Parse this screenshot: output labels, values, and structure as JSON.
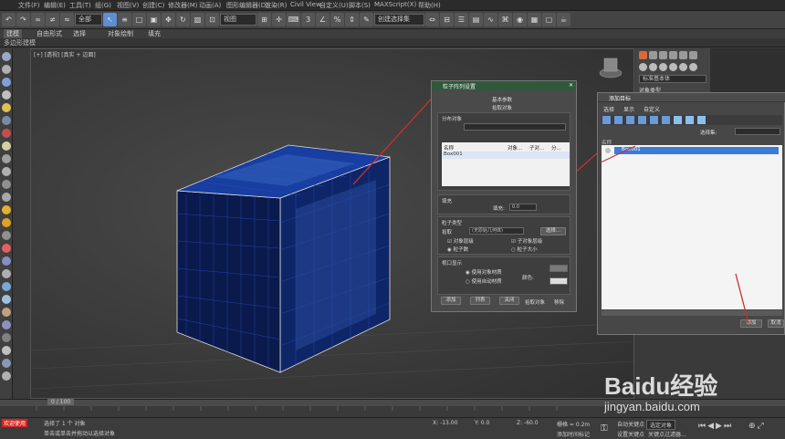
{
  "menu": {
    "items": [
      "文件(F)",
      "编辑(E)",
      "工具(T)",
      "组(G)",
      "视图(V)",
      "创建(C)",
      "修改器(M)",
      "动画(A)",
      "图形编辑器(D)",
      "渲染(R)",
      "Civil View",
      "自定义(U)",
      "脚本(S)",
      "MAXScript(X)",
      "帮助(H)"
    ]
  },
  "toolbar": {
    "selection_filter": "全部",
    "view_select": "视图",
    "named_selection": "创建选择集"
  },
  "ribbon": {
    "tabs": [
      "建模",
      "自由形式",
      "选择",
      "对象绘制",
      "填充"
    ],
    "sub_label": "多边形建模"
  },
  "viewport": {
    "label": "[+] [透视] [真实 + 边面]"
  },
  "command_panel": {
    "dropdown": "标准基本体",
    "rollout": "对象类型"
  },
  "particle_dialog": {
    "title": "粒子阵列设置",
    "sections": {
      "basic": "基本参数",
      "source": "拾取对象",
      "distribution": "分布对象",
      "particles_from_object": "粒子类型",
      "fill": "填充",
      "viewport_display": "视口显示",
      "render": "渲染"
    },
    "table_headers": [
      "名称",
      "对象...",
      "子对...",
      "分..."
    ],
    "table_row": "Box001",
    "fill_label": "填充:",
    "fill_value": "0.0",
    "pick_label": "拾取",
    "none_option": "(无原始几何体)",
    "pick_button": "选择...",
    "checks": [
      "对象层级",
      "子对象层级"
    ],
    "radios": [
      "粒子数",
      "粒子大小"
    ],
    "radio_options": [
      "使用对象材质",
      "使用自动材质"
    ],
    "bottom_buttons": [
      "添加",
      "列表",
      "关闭",
      "移除"
    ],
    "color_label": "颜色:",
    "bottom_extra": "拾取对象"
  },
  "add_dialog": {
    "title": "添加目标",
    "menu": [
      "选择",
      "显示",
      "自定义"
    ],
    "section_label": "名称",
    "selection_set_label": "选择集:",
    "list_item": "Box001",
    "ok": "添加",
    "cancel": "取消"
  },
  "timeline": {
    "frame": "0 / 100",
    "ticks": [
      "0",
      "5",
      "10",
      "15",
      "20",
      "25",
      "30",
      "35",
      "40",
      "45",
      "50",
      "55",
      "60",
      "65",
      "70",
      "75",
      "80",
      "85",
      "90",
      "95",
      "100"
    ]
  },
  "status": {
    "message": "选择了 1 个 对象",
    "hint": "单击或单击并拖动以选择对象",
    "x": "X: -13.00",
    "y": "Y: 0.0",
    "z": "Z: -60.0",
    "grid": "栅格 = 0.2m",
    "add_key": "添加时间标记",
    "auto_key": "自动关键点",
    "selected": "选定对象",
    "set_key": "设置关键点",
    "key_filter": "关键点过滤器...",
    "welcome": "欢迎使用"
  },
  "watermark": {
    "brand": "Baidu经验",
    "url": "jingyan.baidu.com"
  },
  "colors": {
    "cube_face": "#0b1f5c",
    "cube_grid": "#1e3a9e",
    "accent_blue": "#3c7ad8",
    "arrow_red": "#c83030"
  }
}
